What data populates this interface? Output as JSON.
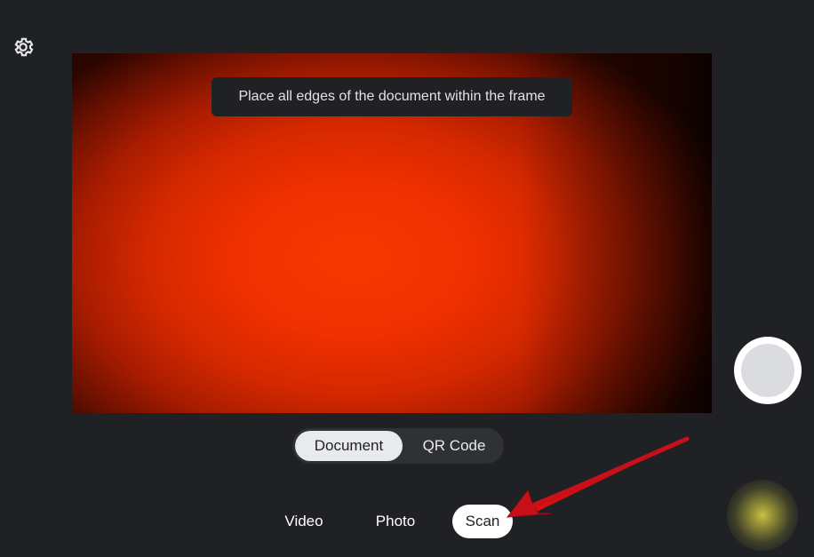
{
  "window": {
    "background": "#202124"
  },
  "toolbar": {
    "settings_icon": "gear-icon"
  },
  "preview": {
    "hint_text": "Place all edges of the document within the frame",
    "accent": "#f03000"
  },
  "doc_toggle": {
    "options": [
      {
        "label": "Document",
        "selected": true
      },
      {
        "label": "QR Code",
        "selected": false
      }
    ]
  },
  "modes": {
    "items": [
      {
        "label": "Video",
        "selected": false
      },
      {
        "label": "Photo",
        "selected": false
      },
      {
        "label": "Scan",
        "selected": true
      }
    ]
  },
  "shutter": {
    "icon": "shutter-button"
  },
  "annotation": {
    "color": "#c8101a",
    "icon": "red-arrow-annotation"
  }
}
